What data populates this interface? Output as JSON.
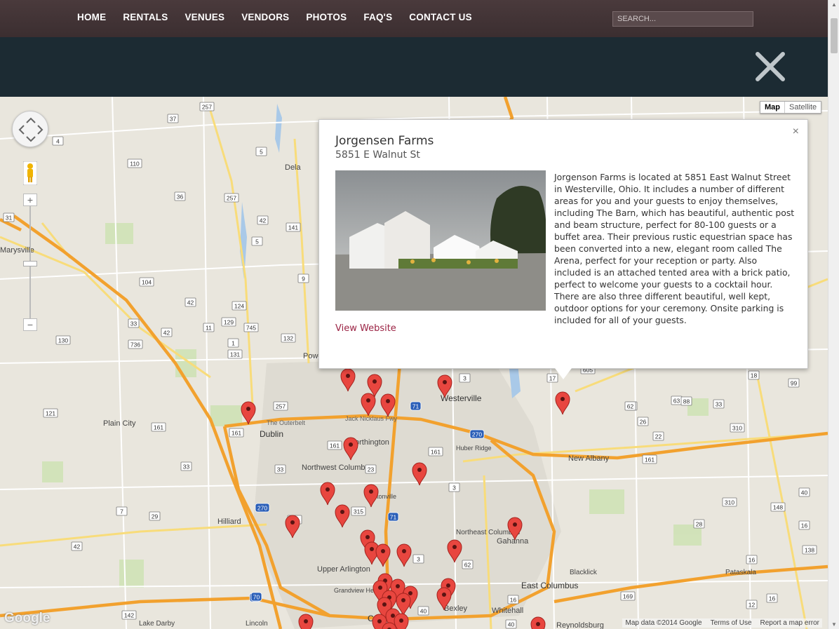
{
  "nav": {
    "items": [
      "HOME",
      "RENTALS",
      "VENUES",
      "VENDORS",
      "PHOTOS",
      "FAQ'S",
      "CONTACT US"
    ],
    "search_placeholder": "SEARCH..."
  },
  "overlay": {
    "close_icon": "close-x-icon"
  },
  "map": {
    "type_buttons": {
      "map": "Map",
      "satellite": "Satellite"
    },
    "zoom_in": "+",
    "zoom_out": "−",
    "logo": "Google",
    "attribution": "Map data ©2014 Google",
    "terms": "Terms of Use",
    "report": "Report a map error",
    "places": [
      {
        "name": "Delaware",
        "label": "Dela"
      },
      {
        "name": "Marysville",
        "label": "Marysville"
      },
      {
        "name": "Powell",
        "label": "Powe"
      },
      {
        "name": "Westerville",
        "label": "Westerville"
      },
      {
        "name": "The Outerbelt",
        "label": "The Outerbelt"
      },
      {
        "name": "Jack Nicklaus Fwy",
        "label": "Jack Nicklaus Fwy"
      },
      {
        "name": "Plain City",
        "label": "Plain City"
      },
      {
        "name": "Dublin",
        "label": "Dublin"
      },
      {
        "name": "Worthington",
        "label": "orthington"
      },
      {
        "name": "Huber Ridge",
        "label": "Huber Ridge"
      },
      {
        "name": "New Albany",
        "label": "New Albany"
      },
      {
        "name": "Northwest Columbus",
        "label": "Northwest Columbus"
      },
      {
        "name": "Hilliard",
        "label": "Hilliard"
      },
      {
        "name": "Clintonville",
        "label": "ntonville"
      },
      {
        "name": "Northeast Columbus",
        "label": "Northeast Columbus"
      },
      {
        "name": "Gahanna",
        "label": "Gahanna"
      },
      {
        "name": "Upper Arlington",
        "label": "Upper Arlington"
      },
      {
        "name": "Grandview Heights",
        "label": "Grandview Heights"
      },
      {
        "name": "Blacklick",
        "label": "Blacklick"
      },
      {
        "name": "Pataskala",
        "label": "Pataskala"
      },
      {
        "name": "East Columbus",
        "label": "East Columbus"
      },
      {
        "name": "Bexley",
        "label": "Bexley"
      },
      {
        "name": "Whitehall",
        "label": "Whitehall"
      },
      {
        "name": "Lake Darby",
        "label": "Lake Darby"
      },
      {
        "name": "Lincoln",
        "label": "Lincoln"
      },
      {
        "name": "Reynoldsburg",
        "label": "Reynoldsburg"
      },
      {
        "name": "Columbus",
        "label": "Columbus"
      }
    ],
    "route_shields": [
      "257",
      "37",
      "4",
      "5",
      "110",
      "36",
      "257",
      "42",
      "141",
      "31",
      "5",
      "104",
      "9",
      "42",
      "124",
      "33",
      "42",
      "129",
      "745",
      "11",
      "130",
      "736",
      "1",
      "131",
      "132",
      "121",
      "161",
      "257",
      "161",
      "161",
      "33",
      "270",
      "33",
      "7",
      "29",
      "42",
      "161",
      "23",
      "315",
      "71",
      "270",
      "3",
      "161",
      "3",
      "62",
      "3",
      "71",
      "17",
      "605",
      "18",
      "99",
      "62",
      "63",
      "88",
      "26",
      "33",
      "22",
      "310",
      "161",
      "148",
      "40",
      "310",
      "16",
      "28",
      "138",
      "16",
      "62",
      "16",
      "169",
      "70",
      "142",
      "70",
      "40",
      "12",
      "40",
      "16"
    ]
  },
  "info": {
    "title": "Jorgensen Farms",
    "address": "5851 E Walnut St",
    "close": "×",
    "description": "Jorgenson Farms is located at 5851 East Walnut Street in Westerville, Ohio. It includes a number of different areas for you and your guests to enjoy themselves, including The Barn, which has beautiful, authentic post and beam structure, perfect for 80-100 guests or a buffet area. Their previous rustic equestrian space has been converted into a new, elegant room called The Arena, perfect for your reception or party. Also included is an attached tented area with a brick patio, perfect to welcome your guests to a cocktail hour. There are also three different beautiful, well kept, outdoor options for your ceremony. Onsite parking is included for all of your guests.",
    "link": "View Website"
  }
}
